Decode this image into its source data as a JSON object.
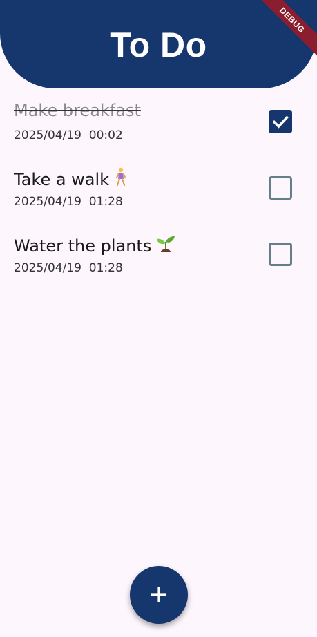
{
  "header": {
    "title": "To Do",
    "background_color": "#15376d"
  },
  "debug_banner": {
    "label": "DEBUG",
    "color": "#8b1e2e"
  },
  "tasks": [
    {
      "title": "Make breakfast",
      "emoji": "",
      "emoji_icon": "",
      "date": "2025/04/19  00:02",
      "completed": true
    },
    {
      "title": "Take a walk",
      "emoji": "🚶‍♀️",
      "emoji_icon": "person-walking-icon",
      "date": "2025/04/19  01:28",
      "completed": false
    },
    {
      "title": "Water the plants",
      "emoji": "🌱",
      "emoji_icon": "seedling-icon",
      "date": "2025/04/19  01:28",
      "completed": false
    }
  ],
  "fab": {
    "icon": "plus-icon",
    "background_color": "#15376d"
  },
  "colors": {
    "background": "#fdf7fd",
    "checkbox_checked": "#15376d",
    "checkbox_unchecked_border": "#667e8a",
    "completed_text": "#8a8a8a"
  }
}
